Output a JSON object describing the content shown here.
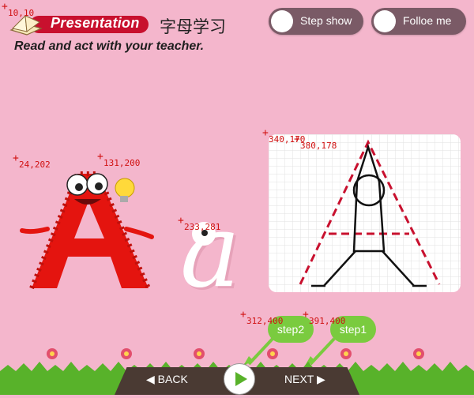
{
  "header": {
    "title": "Presentation",
    "title_cn": "字母学习",
    "subtitle": "Read and act with your teacher."
  },
  "toggles": {
    "step_show": "Step show",
    "follow_me": "Folloe me"
  },
  "coords": {
    "c1": "10,10",
    "c2": "24,202",
    "c3": "131,200",
    "c4": "233,281",
    "c5": "340,170",
    "c6": "380,178",
    "c7": "312,400",
    "c8": "391,400"
  },
  "letter": "a",
  "steps": {
    "step2": "step2",
    "step1": "step1"
  },
  "nav": {
    "back": "BACK",
    "next": "NEXT"
  },
  "colors": {
    "background": "#f4b6cc",
    "header_bar": "#c8102e",
    "mascot_red": "#e4140f",
    "bubble_green": "#7acb3f",
    "guide_red": "#c8102e"
  }
}
